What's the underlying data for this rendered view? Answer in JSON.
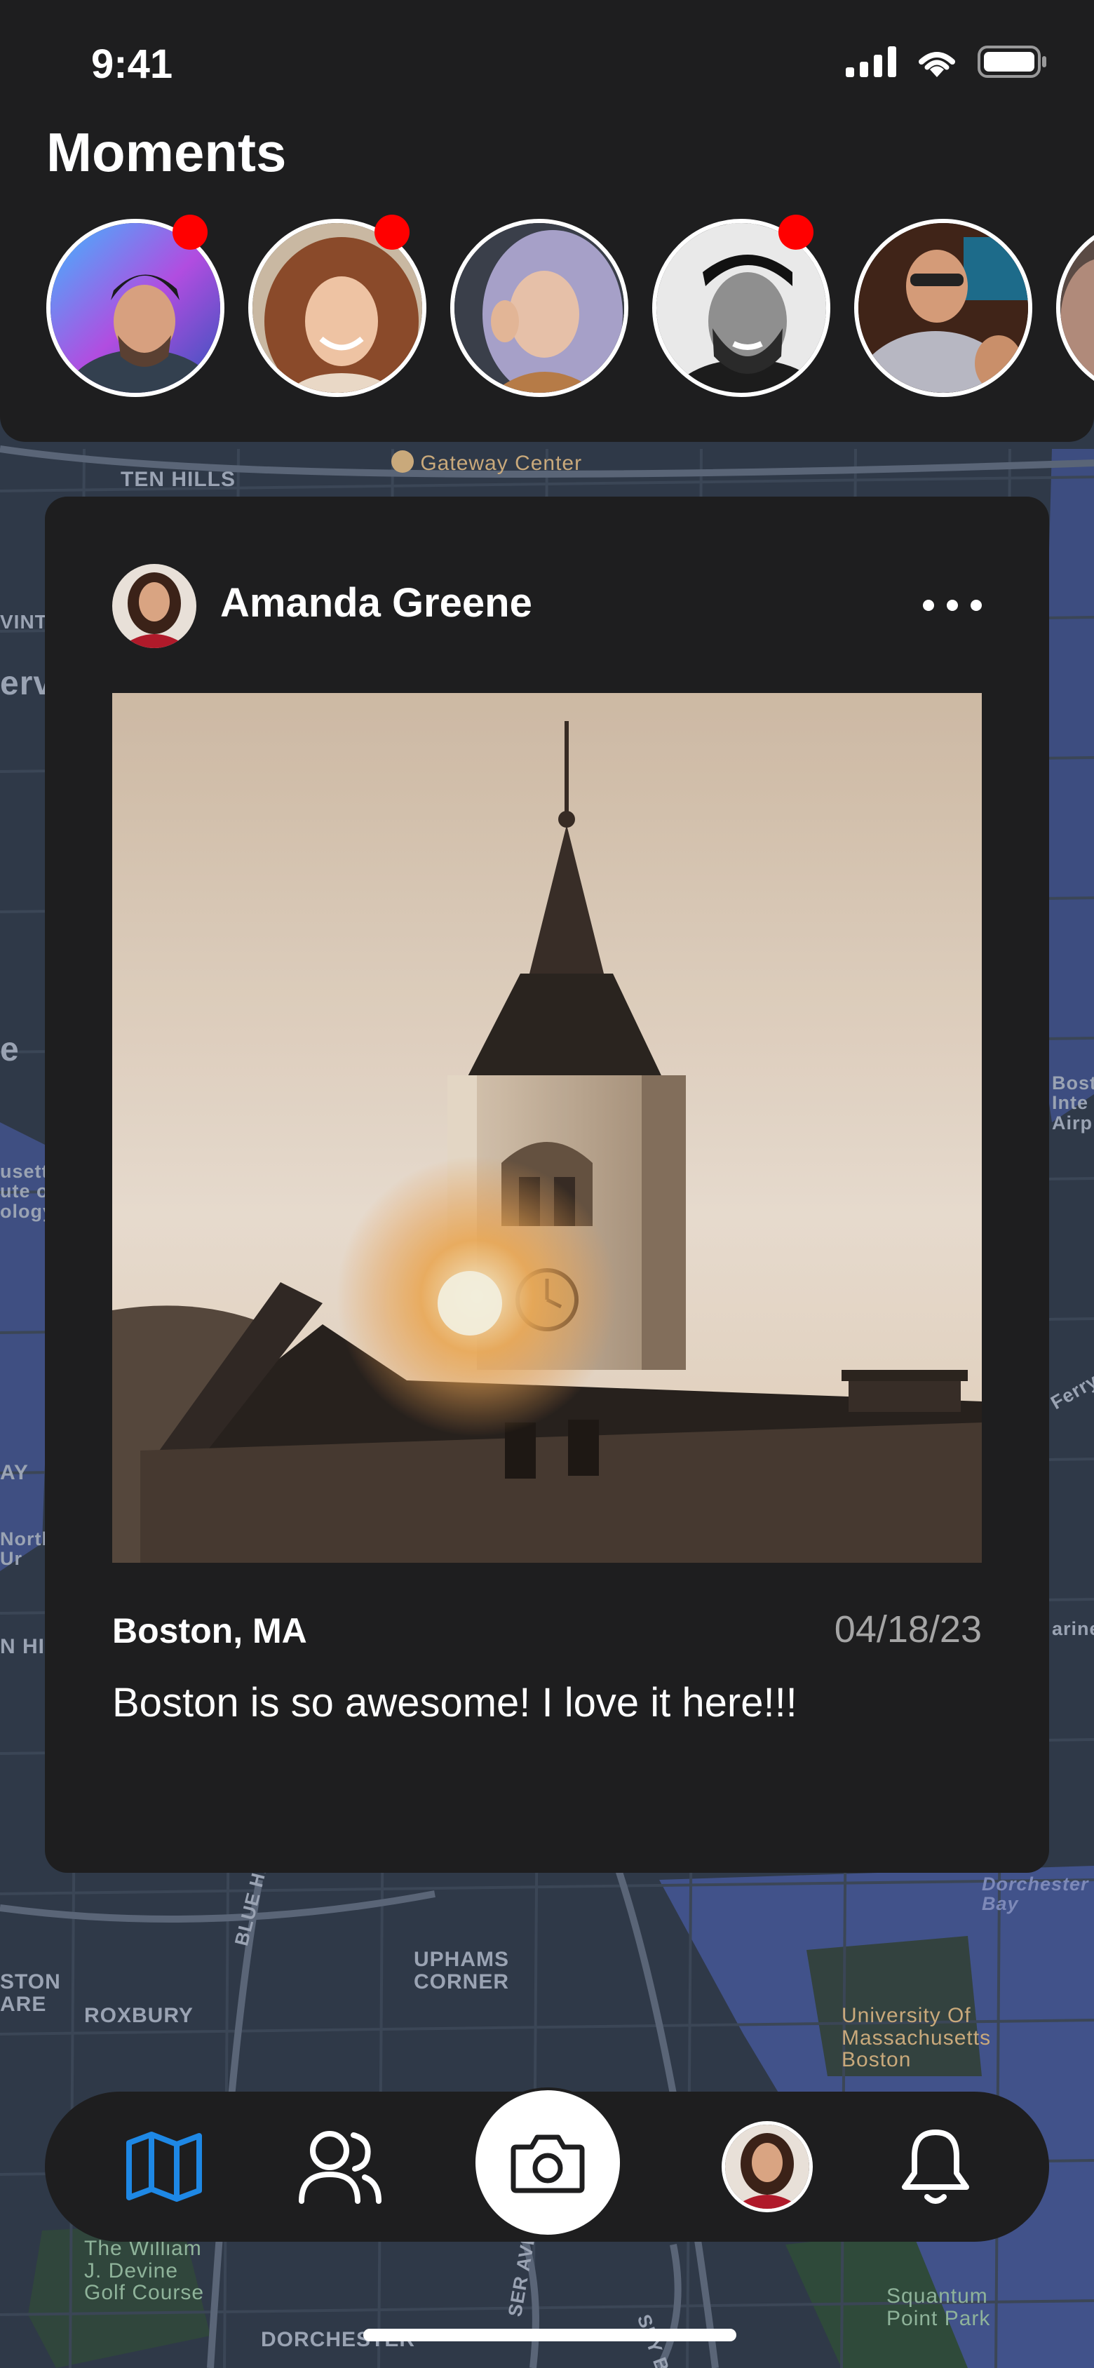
{
  "status_bar": {
    "time": "9:41",
    "icons": [
      "signal-icon",
      "wifi-icon",
      "battery-icon"
    ]
  },
  "header": {
    "title": "Moments"
  },
  "stories": [
    {
      "name": "story-1",
      "has_new": true
    },
    {
      "name": "story-2",
      "has_new": true
    },
    {
      "name": "story-3",
      "has_new": false
    },
    {
      "name": "story-4",
      "has_new": true
    },
    {
      "name": "story-5",
      "has_new": false
    }
  ],
  "post": {
    "author": "Amanda Greene",
    "location": "Boston, MA",
    "date": "04/18/23",
    "caption": "Boston is so awesome! I love it here!!!"
  },
  "map_labels": {
    "ten_hills": "TEN HILLS",
    "gateway": "Gateway Center",
    "uphams": "UPHAMS\nCORNER",
    "roxbury": "ROXBURY",
    "blue_hill": "BLUE HILL AVE",
    "umass": "University Of\nMassachusetts\nBoston",
    "devine": "The William\nJ. Devine\nGolf Course",
    "dorchester": "DORCHESTER",
    "squantum": "Squantum\nPoint Park",
    "dorchester_bay": "Dorchester\nBay",
    "boston_airport": "Bost\nInte\nAirp",
    "ferry": "Ferry",
    "marine": "arine",
    "ston_are": "STON\nARE",
    "winte": "VINTE",
    "erv": "erv",
    "e": "e",
    "usett": "usett\nute o\nology",
    "ay": "AY",
    "north": "North\nUr",
    "n_hil": "N HIL",
    "ser_ave": "SER AVE",
    "sey_blv": "SEY BLV"
  },
  "tabbar": {
    "items": [
      "map-icon",
      "friends-icon",
      "camera-icon",
      "profile-avatar",
      "bell-icon"
    ],
    "accent": "#1e88e5"
  },
  "colors": {
    "panel": "#1e1e1f",
    "notification": "#ff0000",
    "map": "#2d3746"
  }
}
